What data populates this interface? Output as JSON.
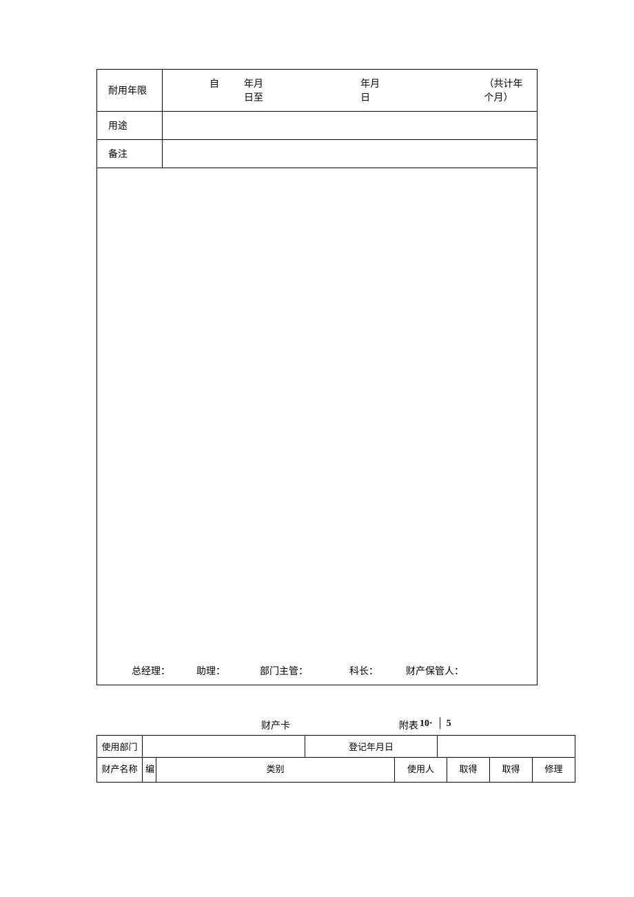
{
  "top_table": {
    "durable_years_label": "耐用年限",
    "durable_years_value": {
      "from_label": "自",
      "ym_to_label": "年月日至",
      "ym_label": "年月日",
      "total_label": "（共计年个月）"
    },
    "usage_label": "用途",
    "usage_value": "",
    "remark_label": "备注",
    "remark_value": ""
  },
  "signatures": {
    "manager": "总经理：",
    "assistant": "助理：",
    "dept_head": "部门主管：",
    "section_chief": "科长：",
    "custodian": "财产保管人："
  },
  "card_header": {
    "title": "财产卡",
    "attach_label": "附表",
    "attach_num": "10·",
    "pipe": "│",
    "attach5": "5"
  },
  "card_table": {
    "r1c1": "使用部门",
    "r1c2": "",
    "r1c3": "登记年月日",
    "r1c4": "",
    "r2c1": "财产名称",
    "r2c2": "编",
    "r2c3": "类别",
    "r2c4": "使用人",
    "r2c5": "取得",
    "r2c6": "取得",
    "r2c7": "修理"
  }
}
